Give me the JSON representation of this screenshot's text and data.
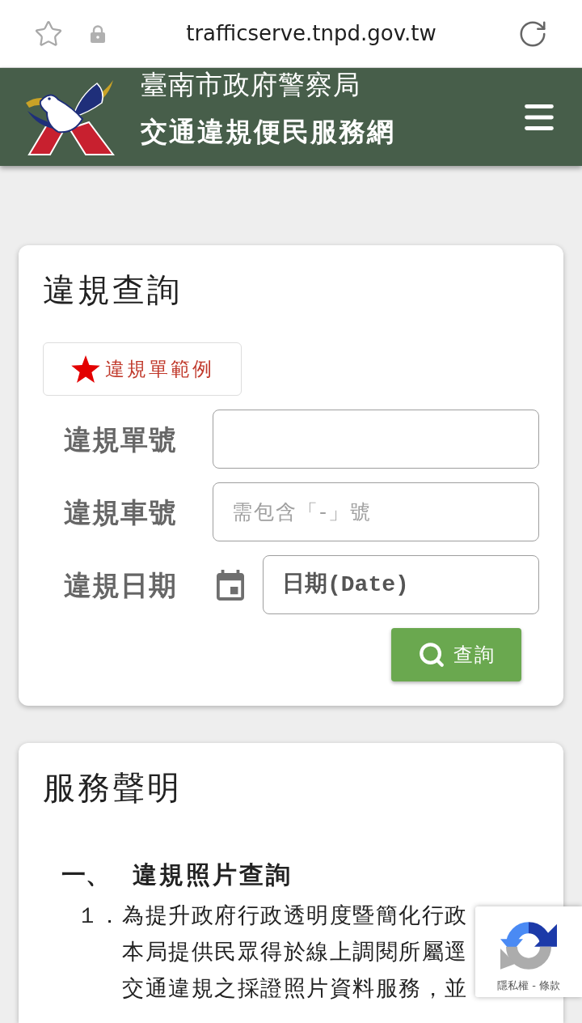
{
  "browser": {
    "url": "trafficserve.tnpd.gov.tw"
  },
  "header": {
    "agency": "臺南市政府警察局",
    "site_title": "交通違規便民服務網"
  },
  "query": {
    "title": "違規查詢",
    "example_button": "違規單範例",
    "fields": [
      {
        "kind": "text",
        "label": "違規單號"
      },
      {
        "kind": "text",
        "label": "違規車號",
        "placeholder": "需包含「-」號"
      },
      {
        "kind": "date",
        "label": "違規日期",
        "placeholder": "日期(Date)"
      }
    ],
    "search_button": "查詢"
  },
  "notice": {
    "title": "服務聲明",
    "sections": [
      {
        "number": "一、",
        "heading": "違規照片查詢",
        "items": [
          {
            "number": "１．",
            "lines": [
              "為提升政府行政透明度暨簡化行政",
              "本局提供民眾得於線上調閱所屬逕",
              "交通違規之採證照片資料服務，並"
            ]
          }
        ]
      }
    ]
  },
  "recaptcha": {
    "links": [
      "隱私權",
      "條款"
    ],
    "separator": "-"
  }
}
